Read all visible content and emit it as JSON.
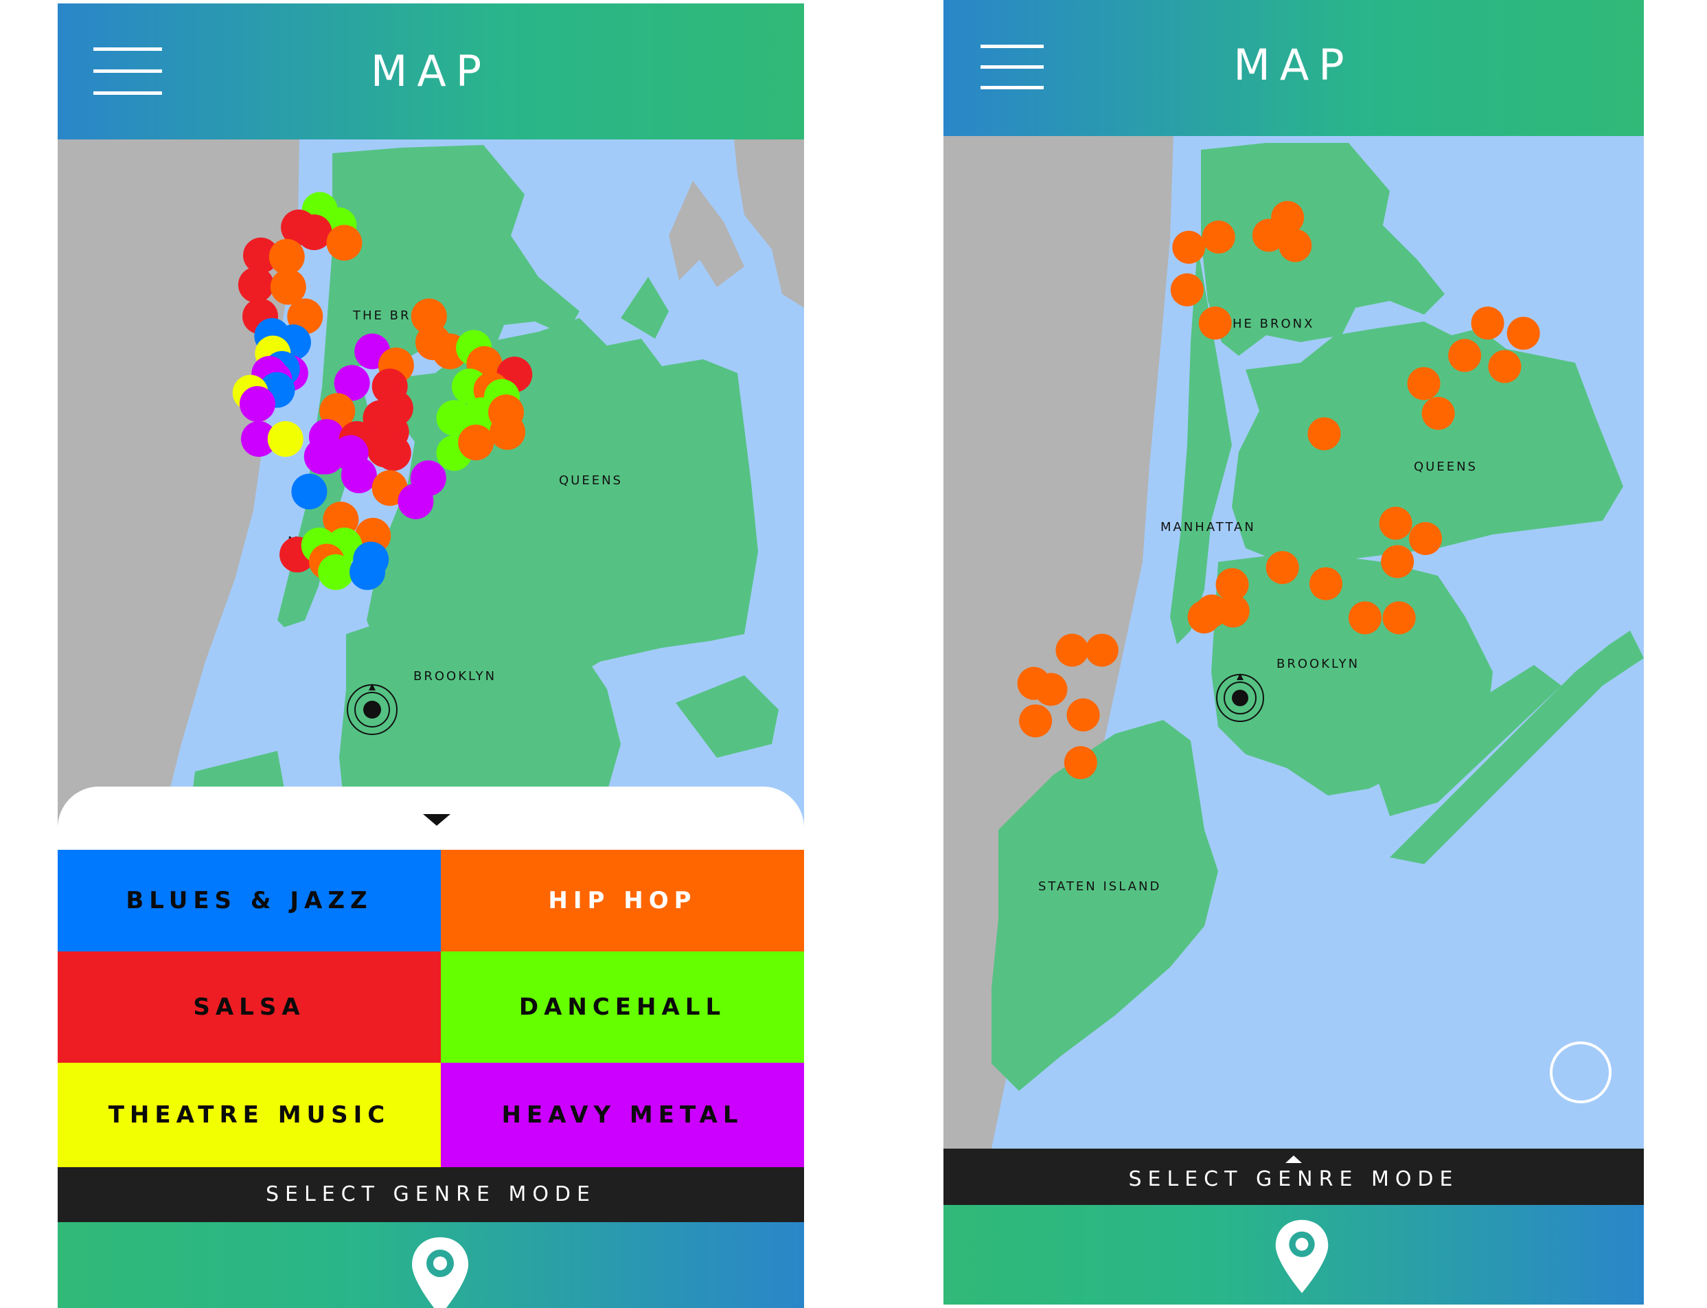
{
  "left_screen": {
    "header": {
      "title": "MAP"
    },
    "map": {
      "labels": {
        "bronx": "THE BRONX",
        "queens": "QUEENS",
        "manhattan": "MANHATTAN",
        "brooklyn": "BROOKLYN"
      }
    },
    "genres": [
      {
        "label": "BLUES & JAZZ",
        "color": "#0079fe",
        "text_color": "#0b0b0b"
      },
      {
        "label": "HIP HOP",
        "color": "#ff6600",
        "text_color": "#ffffff"
      },
      {
        "label": "SALSA",
        "color": "#ee1d24",
        "text_color": "#0b0b0b"
      },
      {
        "label": "DANCEHALL",
        "color": "#66ff00",
        "text_color": "#0b0b0b"
      },
      {
        "label": "THEATRE MUSIC",
        "color": "#f2ff00",
        "text_color": "#0b0b0b"
      },
      {
        "label": "HEAVY METAL",
        "color": "#cc00ff",
        "text_color": "#0b0b0b"
      }
    ],
    "select_bar": {
      "label": "SELECT GENRE MODE"
    }
  },
  "right_screen": {
    "header": {
      "title": "MAP"
    },
    "map": {
      "labels": {
        "bronx": "THE BRONX",
        "queens": "QUEENS",
        "manhattan": "MANHATTAN",
        "brooklyn": "BROOKLYN",
        "staten_island": "STATEN ISLAND"
      },
      "active_genre_color": "#ff6600"
    },
    "select_bar": {
      "label": "SELECT GENRE MODE"
    }
  },
  "colors": {
    "water": "#a3cbfa",
    "land": "#55c283",
    "neighbor_land": "#b3b3b3",
    "header_gradient_start": "#2a86c9",
    "header_gradient_end": "#30b977",
    "bar": "#1f1f1f"
  },
  "icons": {
    "menu": "hamburger-menu-icon",
    "location": "location-pin-icon",
    "current_location": "current-location-icon",
    "collapse": "chevron-down-icon",
    "expand": "chevron-up-icon"
  }
}
